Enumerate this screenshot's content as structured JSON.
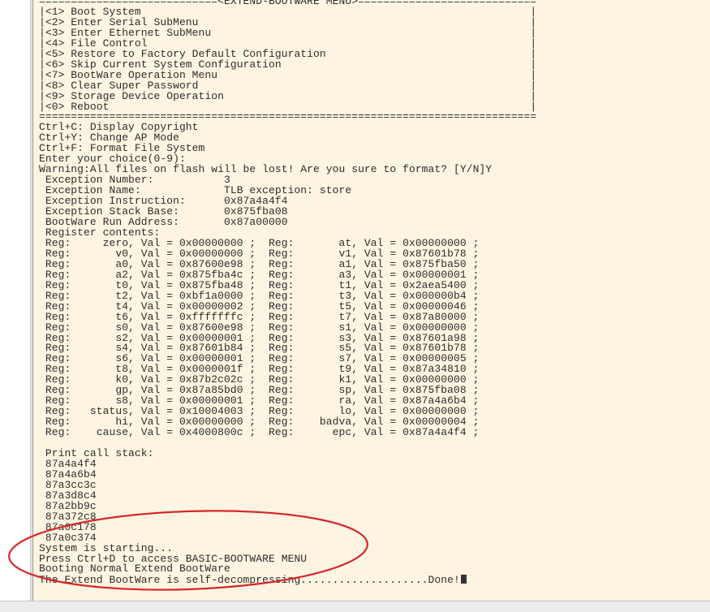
{
  "terminal": {
    "lines": [
      "============================<EXTEND-BOOTWARE MENU>============================",
      "|<1> Boot System                                                             |",
      "|<2> Enter Serial SubMenu                                                    |",
      "|<3> Enter Ethernet SubMenu                                                  |",
      "|<4> File Control                                                            |",
      "|<5> Restore to Factory Default Configuration                                |",
      "|<6> Skip Current System Configuration                                       |",
      "|<7> BootWare Operation Menu                                                 |",
      "|<8> Clear Super Password                                                    |",
      "|<9> Storage Device Operation                                                |",
      "|<0> Reboot                                                                  |",
      "==============================================================================",
      "Ctrl+C: Display Copyright",
      "Ctrl+Y: Change AP Mode",
      "Ctrl+F: Format File System",
      "Enter your choice(0-9):",
      "Warning:All files on flash will be lost! Are you sure to format? [Y/N]Y",
      " Exception Number:           3",
      " Exception Name:             TLB exception: store",
      " Exception Instruction:      0x87a4a4f4",
      " Exception Stack Base:       0x875fba08",
      " BootWare Run Address:       0x87a00000",
      " Register contents:",
      " Reg:     zero, Val = 0x00000000 ;  Reg:       at, Val = 0x00000000 ;",
      " Reg:       v0, Val = 0x00000000 ;  Reg:       v1, Val = 0x87601b78 ;",
      " Reg:       a0, Val = 0x87600e98 ;  Reg:       a1, Val = 0x875fba50 ;",
      " Reg:       a2, Val = 0x875fba4c ;  Reg:       a3, Val = 0x00000001 ;",
      " Reg:       t0, Val = 0x875fba48 ;  Reg:       t1, Val = 0x2aea5400 ;",
      " Reg:       t2, Val = 0xbf1a0000 ;  Reg:       t3, Val = 0x000000b4 ;",
      " Reg:       t4, Val = 0x00000002 ;  Reg:       t5, Val = 0x00000046 ;",
      " Reg:       t6, Val = 0xfffffffc ;  Reg:       t7, Val = 0x87a80000 ;",
      " Reg:       s0, Val = 0x87600e98 ;  Reg:       s1, Val = 0x00000000 ;",
      " Reg:       s2, Val = 0x00000001 ;  Reg:       s3, Val = 0x87601a98 ;",
      " Reg:       s4, Val = 0x87601b84 ;  Reg:       s5, Val = 0x87601b78 ;",
      " Reg:       s6, Val = 0x00000001 ;  Reg:       s7, Val = 0x00000005 ;",
      " Reg:       t8, Val = 0x0000001f ;  Reg:       t9, Val = 0x87a34810 ;",
      " Reg:       k0, Val = 0x87b2c02c ;  Reg:       k1, Val = 0x00000000 ;",
      " Reg:       gp, Val = 0x87a85bd0 ;  Reg:       sp, Val = 0x875fba08 ;",
      " Reg:       s8, Val = 0x00000001 ;  Reg:       ra, Val = 0x87a4a6b4 ;",
      " Reg:   status, Val = 0x10004003 ;  Reg:       lo, Val = 0x00000000 ;",
      " Reg:       hi, Val = 0x00000000 ;  Reg:    badva, Val = 0x00000004 ;",
      " Reg:    cause, Val = 0x4000800c ;  Reg:      epc, Val = 0x87a4a4f4 ;",
      "",
      " Print call stack:",
      " 87a4a4f4",
      " 87a4a6b4",
      " 87a3cc3c",
      " 87a3d8c4",
      " 87a2bb9c",
      " 87a372c8",
      " 87a0c178",
      " 87a0c374",
      "System is starting...",
      "Press Ctrl+D to access BASIC-BOOTWARE MENU",
      "Booting Normal Extend BootWare"
    ],
    "last_line": "The Extend BootWare is self-decompressing....................Done!"
  },
  "colors": {
    "terminal_bg": "#fdf5e2",
    "terminal_text": "#2c2c2c",
    "annotation_ellipse": "#d8252a"
  }
}
